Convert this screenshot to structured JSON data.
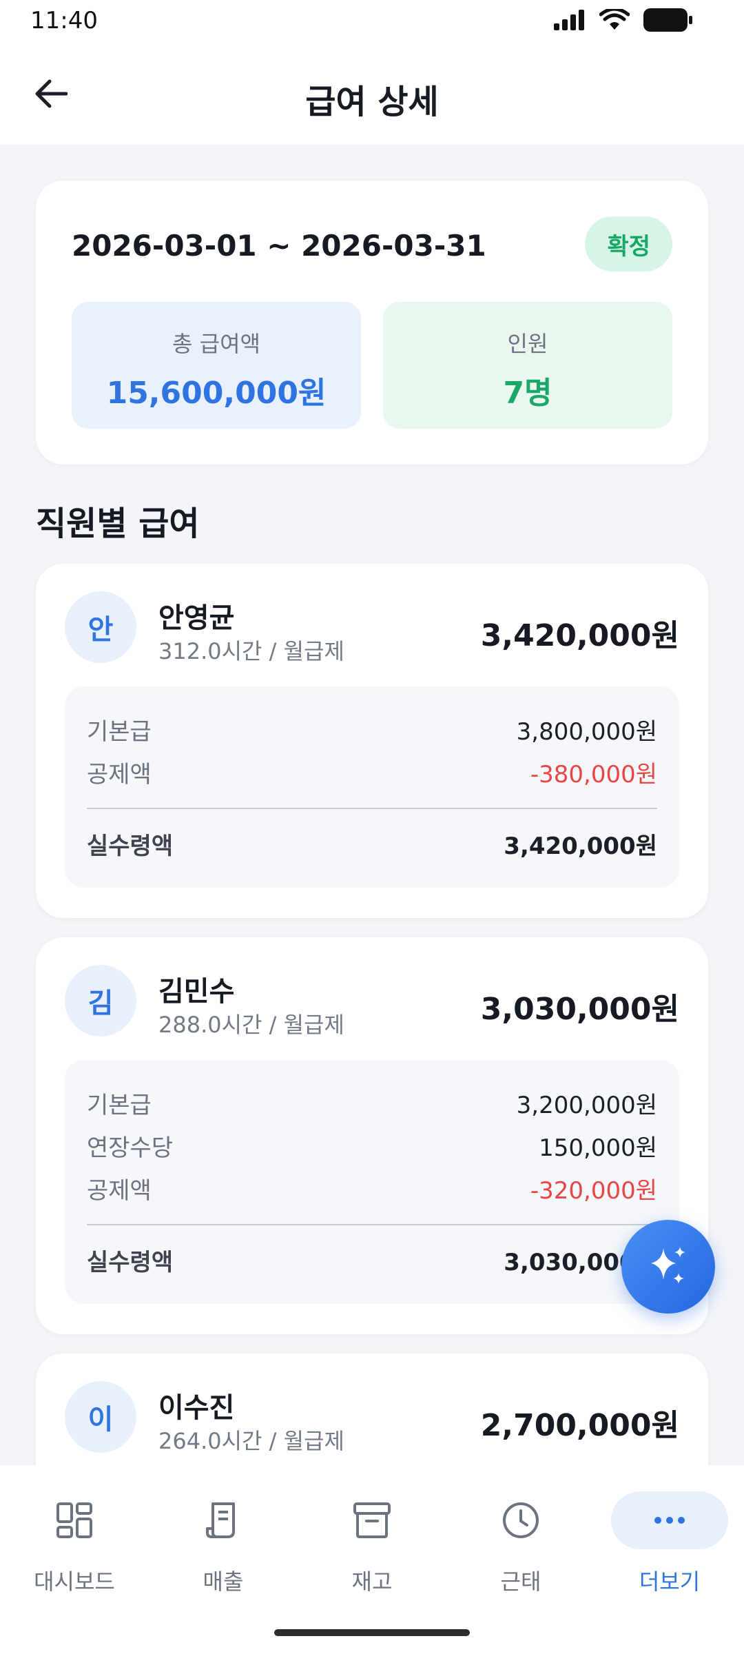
{
  "status_bar": {
    "time": "11:40"
  },
  "header": {
    "title": "급여 상세"
  },
  "summary": {
    "period": "2026-03-01 ~ 2026-03-31",
    "status": "확정",
    "total_label": "총 급여액",
    "total_value": "15,600,000원",
    "count_label": "인원",
    "count_value": "7명"
  },
  "section_title": "직원별 급여",
  "employees": [
    {
      "initial": "안",
      "name": "안영균",
      "meta": "312.0시간 / 월급제",
      "pay": "3,420,000원",
      "rows": [
        {
          "label": "기본급",
          "value": "3,800,000원"
        },
        {
          "label": "공제액",
          "value": "-380,000원"
        }
      ],
      "net_label": "실수령액",
      "net_value": "3,420,000원"
    },
    {
      "initial": "김",
      "name": "김민수",
      "meta": "288.0시간 / 월급제",
      "pay": "3,030,000원",
      "rows": [
        {
          "label": "기본급",
          "value": "3,200,000원"
        },
        {
          "label": "연장수당",
          "value": "150,000원"
        },
        {
          "label": "공제액",
          "value": "-320,000원"
        }
      ],
      "net_label": "실수령액",
      "net_value": "3,030,000원"
    },
    {
      "initial": "이",
      "name": "이수진",
      "meta": "264.0시간 / 월급제",
      "pay": "2,700,000원"
    }
  ],
  "bottom_nav": [
    {
      "label": "대시보드",
      "icon": "dashboard-icon"
    },
    {
      "label": "매출",
      "icon": "receipt-icon"
    },
    {
      "label": "재고",
      "icon": "archive-icon"
    },
    {
      "label": "근태",
      "icon": "clock-icon"
    },
    {
      "label": "더보기",
      "icon": "more-icon",
      "active": true
    }
  ],
  "colors": {
    "accent": "#2f74e0",
    "success": "#1aa868",
    "negative": "#e84545"
  }
}
